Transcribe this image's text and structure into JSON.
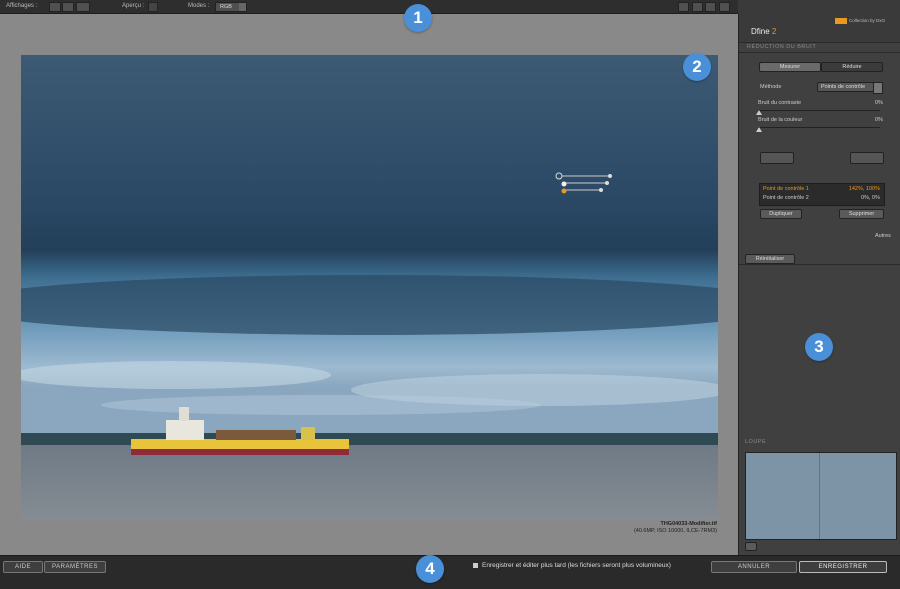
{
  "toolbar": {
    "affichages_label": "Affichages :",
    "apercu_label": "Aperçu :",
    "modes_label": "Modes :",
    "mode_value": "RGB"
  },
  "panel": {
    "brand": "Collection by DxO",
    "title_main": "Dfine",
    "title_num": "2",
    "section_title": "RÉDUCTION DU BRUIT",
    "tabs": [
      "Mesurer",
      "Réduire"
    ],
    "method_label": "Méthode",
    "method_value": "Points de contrôle",
    "contrast_label": "Bruit du contraste",
    "contrast_value": "0%",
    "color_label": "Bruit de la couleur",
    "color_value": "0%",
    "control_points": [
      {
        "name": "Point de contrôle 1",
        "value": "142%, 100%"
      },
      {
        "name": "Point de contrôle 2",
        "value": "0%, 0%"
      }
    ],
    "duplicate_label": "Dupliquer",
    "delete_label": "Supprimer",
    "others_label": "Autres",
    "reset_label": "Réinitialiser",
    "loupe_label": "LOUPE"
  },
  "image": {
    "filename": "THG04033-Modifier.tif",
    "meta": "(40.6MP, ISO 10000, ILCE-7RM3)"
  },
  "footer": {
    "help_label": "AIDE",
    "settings_label": "PARAMÈTRES",
    "save_later_label": "Enregistrer et éditer plus tard (les fichiers seront plus volumineux)",
    "cancel_label": "ANNULER",
    "save_label": "ENREGISTRER"
  },
  "badges": [
    "1",
    "2",
    "3",
    "4"
  ],
  "colors": {
    "accent": "#e89a1c",
    "badge": "#4a90d9"
  }
}
